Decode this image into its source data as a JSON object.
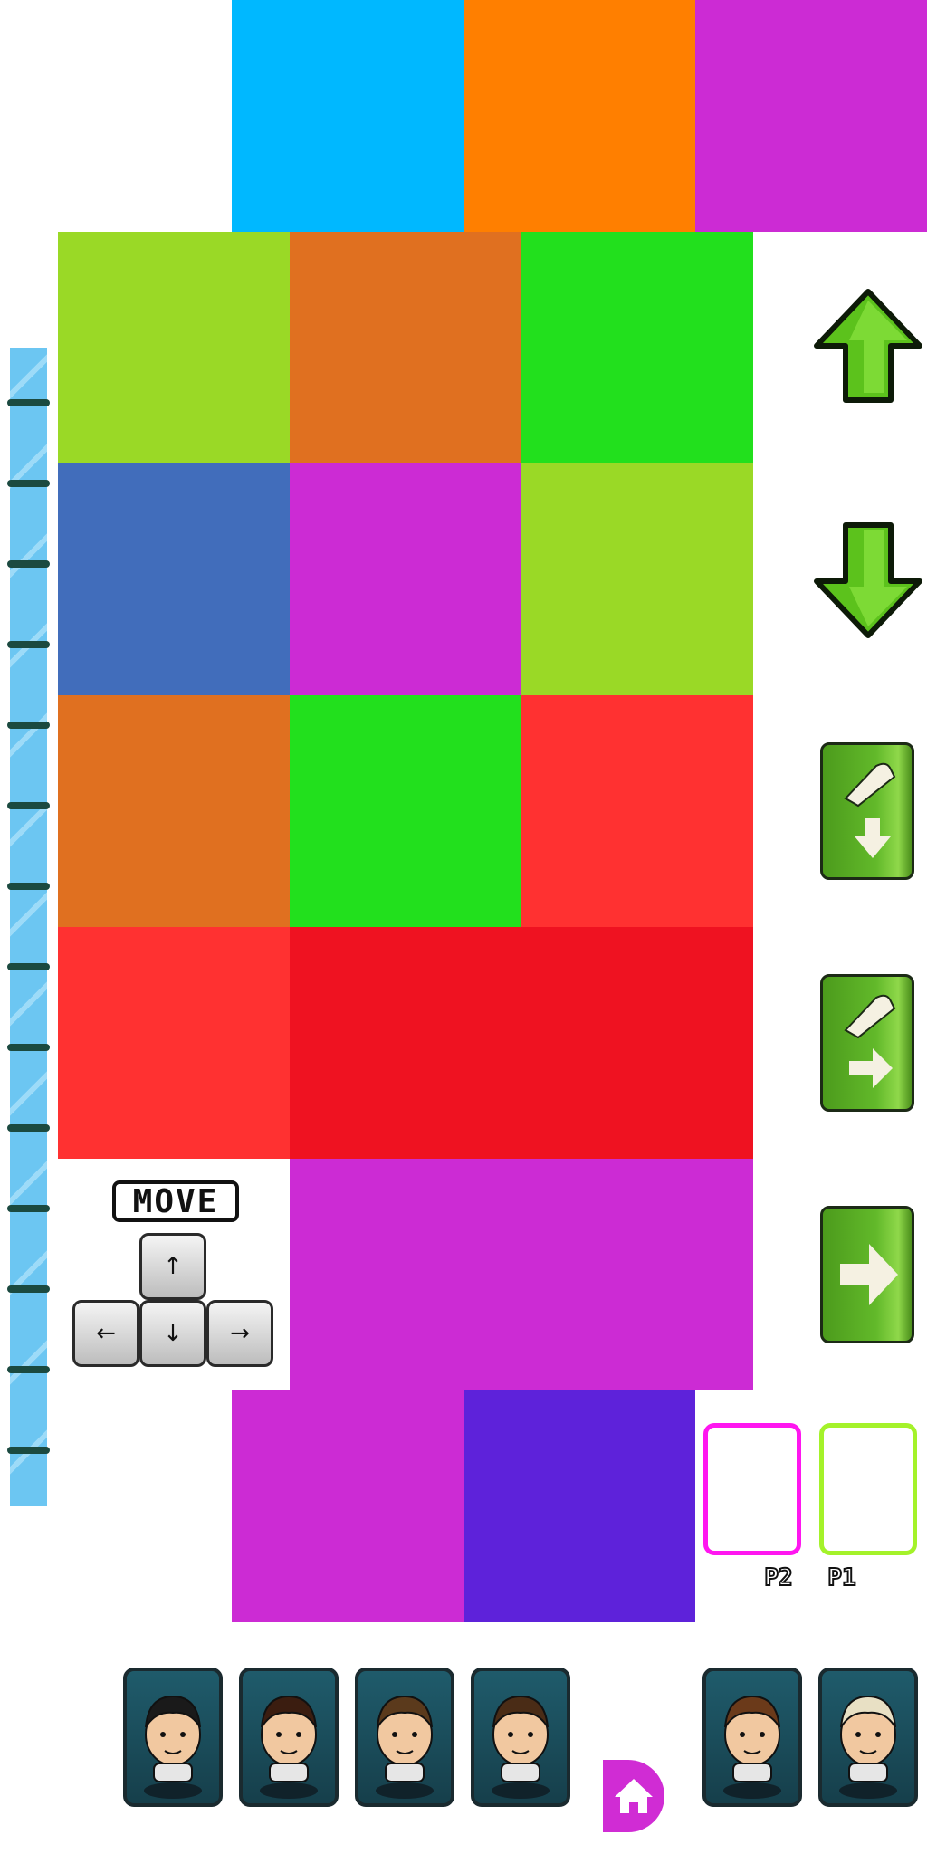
{
  "colors": {
    "cyan": "#00b8ff",
    "orange": "#ff7f00",
    "magenta": "#cc2bd4",
    "lime": "#9ad926",
    "rust": "#e07020",
    "green": "#22e01d",
    "blue": "#416dbb",
    "red": "#ff3131",
    "crimson": "#ef1221",
    "violet": "#5e22da",
    "slot_p2": "#ff16f0",
    "slot_p1": "#a4f22a"
  },
  "controls": {
    "up_icon": "arrow-up-icon",
    "down_icon": "arrow-down-icon",
    "kick_down_icon": "shoe-kick-down-icon",
    "kick_right_icon": "shoe-kick-right-icon",
    "next_icon": "arrow-right-icon"
  },
  "move_panel": {
    "title": "MOVE",
    "keys": [
      "↑",
      "←",
      "↓",
      "→"
    ]
  },
  "slots": {
    "p2_label": "P2",
    "p1_label": "P1"
  },
  "players": [
    {
      "name": "player-uruguay",
      "flag": "uruguay-flag-icon",
      "hair": "#1a1a1a"
    },
    {
      "name": "player-afro",
      "flag": "red-white-flag-icon",
      "hair": "#3b1d10"
    },
    {
      "name": "player-italy",
      "flag": "italy-flag-icon",
      "hair": "#5b3a1c"
    },
    {
      "name": "player-usa",
      "flag": "usa-flag-icon",
      "hair": "#4a2c16"
    },
    {
      "name": "player-argentina",
      "flag": "argentina-flag-icon",
      "hair": "#6b3a1a"
    },
    {
      "name": "player-brazil",
      "flag": "brazil-flag-icon",
      "hair": "#e8e0c4"
    }
  ],
  "home_icon": "home-icon"
}
